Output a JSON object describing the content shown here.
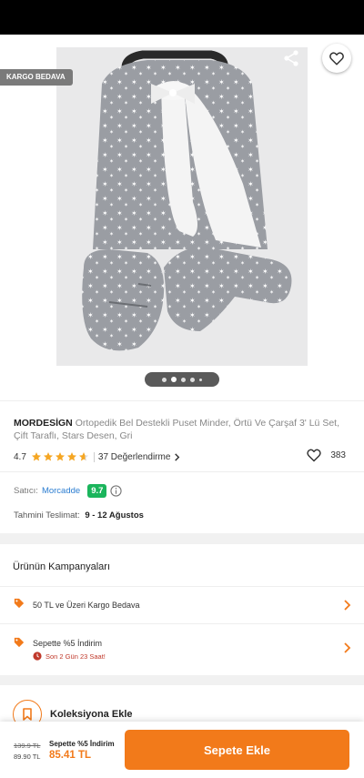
{
  "hero": {
    "badge": "KARGO BEDAVA",
    "icons": {
      "back": "back-arrow-icon",
      "share": "share-icon",
      "favorite": "heart-outline-icon"
    },
    "gallery": {
      "count": 5,
      "active_index": 1
    }
  },
  "product": {
    "brand": "MORDESİGN",
    "name": "Ortopedik Bel Destekli Puset Minder, Örtü Ve Çarşaf 3' Lü Set, Çift Taraflı, Stars Desen, Gri",
    "rating": "4.7",
    "rating_value": 4.7,
    "reviews": "37 Değerlendirme",
    "favorites": "383",
    "seller_label": "Satıcı:",
    "seller_name": "Morcadde",
    "seller_score": "9.7",
    "delivery_label": "Tahmini Teslimat:",
    "delivery_value": "9 - 12 Ağustos"
  },
  "campaigns": {
    "title": "Ürünün Kampanyaları",
    "items": [
      {
        "label": "50 TL ve Üzeri Kargo Bedava"
      },
      {
        "label": "Sepette %5 İndirim",
        "countdown": "Son 2 Gün 23 Saat!"
      }
    ]
  },
  "collection": {
    "label": "Koleksiyona Ekle"
  },
  "bottom": {
    "old_price": "139.9 TL",
    "price": "89.90 TL",
    "promo_label": "Sepette %5 İndirim",
    "promo_price": "85.41 TL",
    "cart_button": "Sepete Ekle"
  },
  "colors": {
    "accent": "#f27a1a",
    "star": "#f5a623",
    "seller_link": "#2b7dd1",
    "score_badge": "#1bb55c"
  }
}
